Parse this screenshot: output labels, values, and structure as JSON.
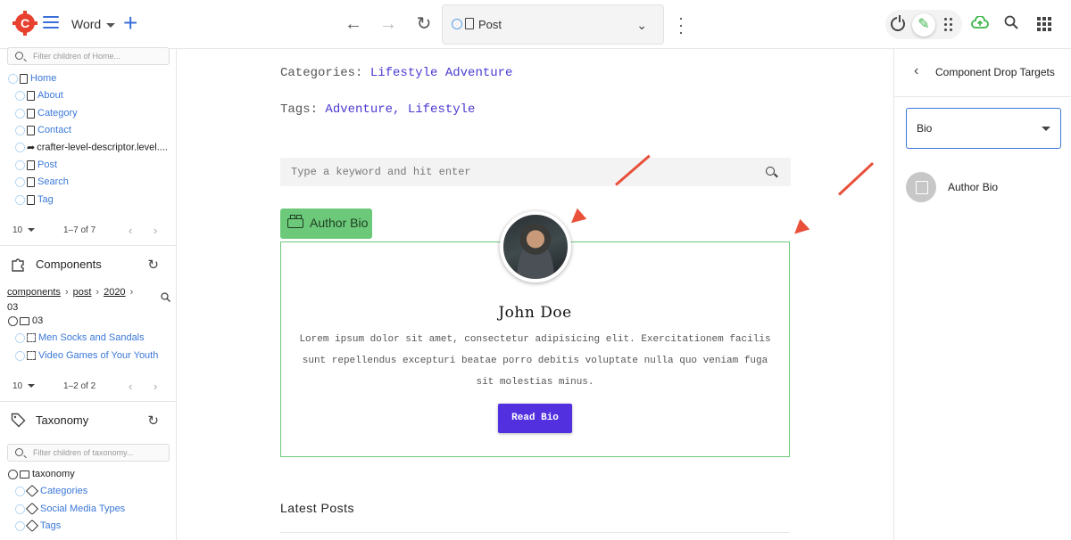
{
  "topbar": {
    "site_label": "Word",
    "address_label": "Post"
  },
  "pages": {
    "filter_placeholder": "Filter children of Home...",
    "items": [
      "Home",
      "About",
      "Category",
      "Contact",
      "crafter-level-descriptor.level....",
      "Post",
      "Search",
      "Tag"
    ],
    "per_page": "10",
    "range": "1–7 of 7"
  },
  "components": {
    "title": "Components",
    "crumbs": [
      "components",
      "post",
      "2020"
    ],
    "crumb_last": "03",
    "folder": "03",
    "items": [
      "Men Socks and Sandals",
      "Video Games of Your Youth"
    ],
    "per_page": "10",
    "range": "1–2 of 2"
  },
  "taxonomy": {
    "title": "Taxonomy",
    "filter_placeholder": "Filter children of taxonomy...",
    "folder": "taxonomy",
    "items": [
      "Categories",
      "Social Media Types",
      "Tags"
    ]
  },
  "main": {
    "categories_label": "Categories:",
    "categories_value": "Lifestyle Adventure",
    "tags_label": "Tags:",
    "tags_value": "Adventure, Lifestyle",
    "search_placeholder": "Type a keyword and hit enter",
    "drop_target_label": "Author Bio",
    "author_name": "John Doe",
    "bio_text": "Lorem ipsum dolor sit amet, consectetur adipisicing elit. Exercitationem facilis sunt repellendus excepturi beatae porro debitis voluptate nulla quo veniam fuga sit molestias minus.",
    "read_bio_label": "Read Bio",
    "latest_posts": "Latest Posts"
  },
  "right_panel": {
    "title": "Component Drop Targets",
    "selected": "Bio",
    "item": "Author Bio"
  },
  "colors": {
    "accent_blue": "#3b78d8",
    "drop_green": "#6cc97a",
    "button_purple": "#5230e0",
    "arrow_red": "#e8503a"
  }
}
